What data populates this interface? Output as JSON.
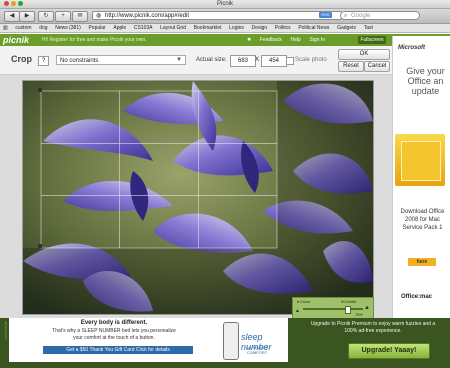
{
  "window": {
    "title": "Picnik"
  },
  "toolbar": {
    "url": "http://www.picnik.com/app#/edit",
    "search_placeholder": "Google",
    "rss_label": "RSS"
  },
  "bookmarks": {
    "items": [
      "custom",
      "dog",
      "News (381)",
      "Popular",
      "Apple",
      "CS103A",
      "Layout Grid",
      "Bookmarklet",
      "Logins",
      "Design",
      "Politics",
      "Political News",
      "Gadgets",
      "Tast"
    ]
  },
  "picnik_header": {
    "logo": "picnik",
    "promo_text": "Hi! Register for free and make Picnik your own.",
    "nav": [
      "Feedback",
      "Help",
      "Sign In"
    ],
    "fullscreen": "Fullscreen"
  },
  "crop_tool": {
    "title": "Crop",
    "help": "?",
    "constraints_value": "No constraints",
    "actual_size_label": "Actual size:",
    "width": "683",
    "x_label": "X",
    "height": "454",
    "scale_label": "Scale photo",
    "ok": "OK",
    "reset": "Reset",
    "cancel": "Cancel"
  },
  "zoom": {
    "label": "Zoom",
    "dimensions": "902x668",
    "percent": "78%",
    "level": 0.78
  },
  "right_ad": {
    "logo": "Microsoft",
    "line1": "Give your Office an update",
    "download": "Download Office 2008 for Mac Service Pack 1",
    "here": "here",
    "office_mac": "Office:mac"
  },
  "bottom_ad": {
    "vertical": "advertisement",
    "headline": "Every body is different.",
    "body1": "That's why a SLEEP NUMBER bed lets you personalize",
    "body2": "your comfort at the touch of a button.",
    "gift": "Get a $50 Thank You Gift Card  Click for details",
    "sleep_logo": "sleep number",
    "sleep_sub": "by SELECT COMFORT",
    "premium": "Upgrade to Picnik Premium to enjoy warm fuzzies and a 100% ad-free experience.",
    "upgrade_button": "Upgrade! Yaaay!"
  },
  "colors": {
    "picnik_green": "#6b9d2a",
    "upgrade_green": "#a4cc56",
    "flower_purple": "#6a5cc8"
  }
}
